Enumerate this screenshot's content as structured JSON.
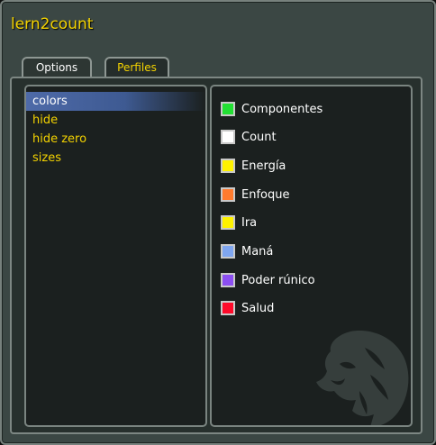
{
  "window": {
    "title": "lern2count"
  },
  "tabs": [
    {
      "label": "Options",
      "active": true
    },
    {
      "label": "Perfiles",
      "active": false
    }
  ],
  "nav": {
    "items": [
      {
        "label": "colors",
        "selected": true
      },
      {
        "label": "hide",
        "selected": false
      },
      {
        "label": "hide zero",
        "selected": false
      },
      {
        "label": "sizes",
        "selected": false
      }
    ]
  },
  "colors": [
    {
      "label": "Componentes",
      "color": "#22e033"
    },
    {
      "label": "Count",
      "color": "#ffffff"
    },
    {
      "label": "Energía",
      "color": "#fff200"
    },
    {
      "label": "Enfoque",
      "color": "#ff7b2e"
    },
    {
      "label": "Ira",
      "color": "#fff200"
    },
    {
      "label": "Maná",
      "color": "#7fa6f0"
    },
    {
      "label": "Poder rúnico",
      "color": "#8c4ff2"
    },
    {
      "label": "Salud",
      "color": "#ff0a2a"
    }
  ],
  "theme": {
    "accent_yellow": "#f3d200",
    "selection_blue": "#4e6aa8"
  },
  "watermark": {
    "icon": "lion-head-icon"
  }
}
